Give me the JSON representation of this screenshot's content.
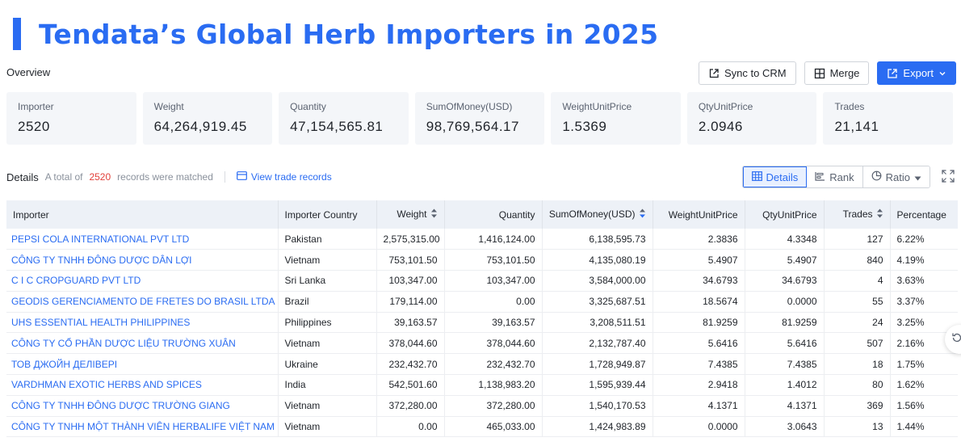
{
  "header": {
    "title": "Tendata’s Global Herb Importers in 2025"
  },
  "overview": {
    "label": "Overview"
  },
  "toolbar": {
    "sync_label": "Sync to CRM",
    "merge_label": "Merge",
    "export_label": "Export"
  },
  "cards": [
    {
      "label": "Importer",
      "value": "2520"
    },
    {
      "label": "Weight",
      "value": "64,264,919.45"
    },
    {
      "label": "Quantity",
      "value": "47,154,565.81"
    },
    {
      "label": "SumOfMoney(USD)",
      "value": "98,769,564.17"
    },
    {
      "label": "WeightUnitPrice",
      "value": "1.5369"
    },
    {
      "label": "QtyUnitPrice",
      "value": "2.0946"
    },
    {
      "label": "Trades",
      "value": "21,141"
    }
  ],
  "details": {
    "label": "Details",
    "total_prefix": "A total of",
    "count": "2520",
    "total_suffix": "records were matched",
    "view_link": "View trade records",
    "views": {
      "details": "Details",
      "rank": "Rank",
      "ratio": "Ratio"
    }
  },
  "table": {
    "headers": [
      "Importer",
      "Importer Country",
      "Weight",
      "Quantity",
      "SumOfMoney(USD)",
      "WeightUnitPrice",
      "QtyUnitPrice",
      "Trades",
      "Percentage"
    ],
    "rows": [
      [
        "PEPSI COLA INTERNATIONAL PVT LTD",
        "Pakistan",
        "2,575,315.00",
        "1,416,124.00",
        "6,138,595.73",
        "2.3836",
        "4.3348",
        "127",
        "6.22%"
      ],
      [
        "CÔNG TY TNHH ĐÔNG DƯỢC DÂN LỢI",
        "Vietnam",
        "753,101.50",
        "753,101.50",
        "4,135,080.19",
        "5.4907",
        "5.4907",
        "840",
        "4.19%"
      ],
      [
        "C I C CROPGUARD PVT LTD",
        "Sri Lanka",
        "103,347.00",
        "103,347.00",
        "3,584,000.00",
        "34.6793",
        "34.6793",
        "4",
        "3.63%"
      ],
      [
        "GEODIS GERENCIAMENTO DE FRETES DO BRASIL LTDA",
        "Brazil",
        "179,114.00",
        "0.00",
        "3,325,687.51",
        "18.5674",
        "0.0000",
        "55",
        "3.37%"
      ],
      [
        "UHS ESSENTIAL HEALTH PHILIPPINES",
        "Philippines",
        "39,163.57",
        "39,163.57",
        "3,208,511.51",
        "81.9259",
        "81.9259",
        "24",
        "3.25%"
      ],
      [
        "CÔNG TY CỔ PHẦN DƯỢC LIỆU TRƯỜNG XUÂN",
        "Vietnam",
        "378,044.60",
        "378,044.60",
        "2,132,787.40",
        "5.6416",
        "5.6416",
        "507",
        "2.16%"
      ],
      [
        "ТОВ ДЖОЙН ДЕЛІВЕРІ",
        "Ukraine",
        "232,432.70",
        "232,432.70",
        "1,728,949.87",
        "7.4385",
        "7.4385",
        "18",
        "1.75%"
      ],
      [
        "VARDHMAN EXOTIC HERBS AND SPICES",
        "India",
        "542,501.60",
        "1,138,983.20",
        "1,595,939.44",
        "2.9418",
        "1.4012",
        "80",
        "1.62%"
      ],
      [
        "CÔNG TY TNHH ĐÔNG DƯỢC TRƯỜNG GIANG",
        "Vietnam",
        "372,280.00",
        "372,280.00",
        "1,540,170.53",
        "4.1371",
        "4.1371",
        "369",
        "1.56%"
      ],
      [
        "CÔNG TY TNHH MỘT THÀNH VIÊN HERBALIFE VIỆT NAM",
        "Vietnam",
        "0.00",
        "465,033.00",
        "1,424,983.89",
        "0.0000",
        "3.0643",
        "13",
        "1.44%"
      ]
    ]
  },
  "colors": {
    "accent": "#2a6cf2",
    "count": "#e2403a",
    "header_bg": "#edf1f7",
    "card_bg": "#f4f6f9"
  }
}
